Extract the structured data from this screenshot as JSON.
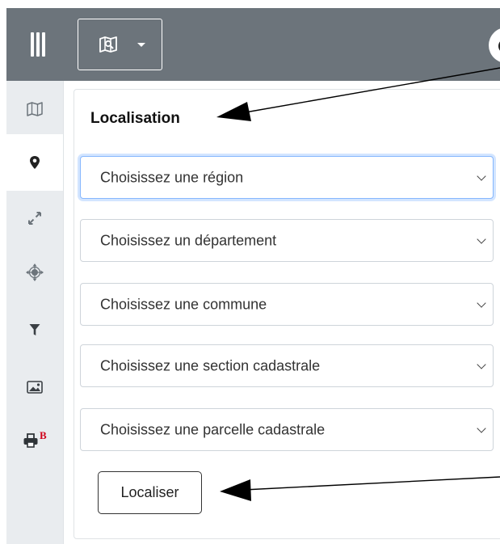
{
  "header": {
    "menu_icon": "hamburger-icon",
    "map_menu_icon": "map-icon",
    "user_icon": "user-avatar"
  },
  "sidebar": {
    "items": [
      {
        "icon": "map-icon",
        "active": false
      },
      {
        "icon": "location-pin-icon",
        "active": true
      },
      {
        "icon": "expand-icon",
        "active": false
      },
      {
        "icon": "move-arrows-icon",
        "active": false
      },
      {
        "icon": "filter-icon",
        "active": false
      },
      {
        "icon": "image-icon",
        "active": false
      },
      {
        "icon": "print-icon",
        "active": false,
        "badge": "B"
      }
    ]
  },
  "panel": {
    "title": "Localisation",
    "selects": [
      {
        "label": "Choisissez une région"
      },
      {
        "label": "Choisissez un département"
      },
      {
        "label": "Choisissez une commune"
      },
      {
        "label": "Choisissez une section cadastrale"
      },
      {
        "label": "Choisissez une parcelle cadastrale"
      }
    ],
    "submit_label": "Localiser"
  },
  "colors": {
    "topbar": "#6c747b",
    "sidebar": "#e9ecef",
    "focus_border": "#86b7fe",
    "badge": "#d0021b"
  }
}
